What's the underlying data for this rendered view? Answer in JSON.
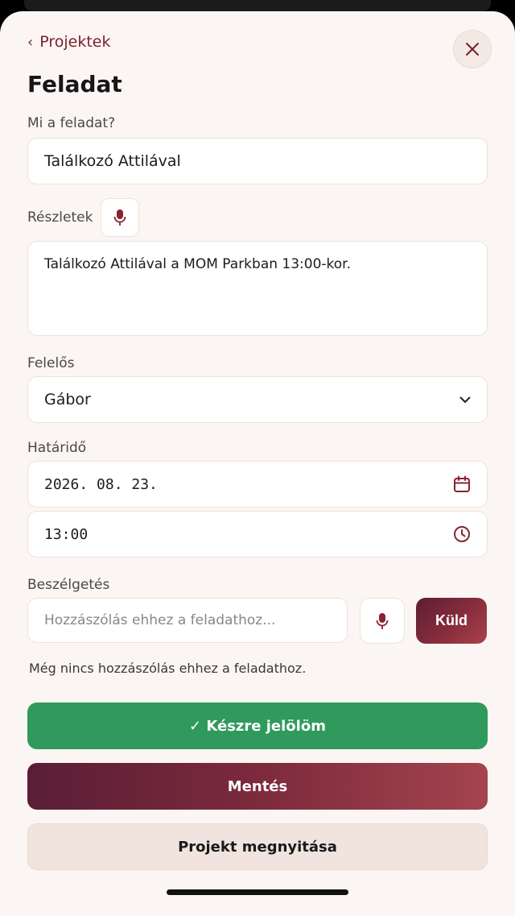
{
  "header": {
    "back_label": "Projektek",
    "title": "Feladat"
  },
  "form": {
    "task_label": "Mi a feladat?",
    "task_value": "Találkozó Attilával",
    "details_label": "Részletek",
    "details_value": "Találkozó Attilával a MOM Parkban 13:00-kor.",
    "assignee_label": "Felelős",
    "assignee_value": "Gábor",
    "deadline_label": "Határidő",
    "date_value": "2026. 08. 23.",
    "time_value": "13:00"
  },
  "conversation": {
    "label": "Beszélgetés",
    "placeholder": "Hozzászólás ehhez a feladathoz...",
    "send_label": "Küld",
    "empty_text": "Még nincs hozzászólás ehhez a feladathoz."
  },
  "actions": {
    "done_label": "✓ Készre jelölöm",
    "save_label": "Mentés",
    "open_project_label": "Projekt megnyitása"
  },
  "colors": {
    "accent": "#7b1f2a",
    "success": "#2f9a5c",
    "background": "#fbf6f3"
  },
  "icons": [
    "chevron-left-icon",
    "close-icon",
    "microphone-icon",
    "chevron-down-icon",
    "calendar-icon",
    "clock-icon"
  ]
}
